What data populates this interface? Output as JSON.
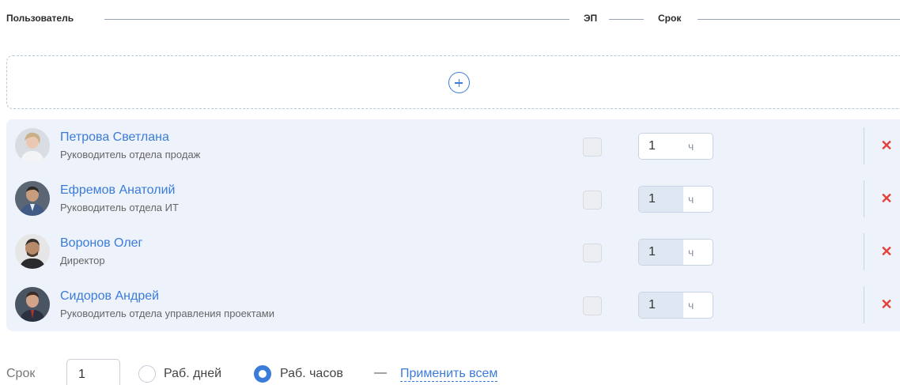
{
  "header": {
    "user_label": "Пользователь",
    "ep_label": "ЭП",
    "term_label": "Срок"
  },
  "add_zone": {
    "icon": "plus-circle-icon"
  },
  "users": [
    {
      "name": "Петрова Светлана",
      "role": "Руководитель отдела продаж",
      "ep_checked": false,
      "term_value": "1",
      "term_unit": "ч"
    },
    {
      "name": "Ефремов Анатолий",
      "role": "Руководитель отдела ИТ",
      "ep_checked": false,
      "term_value": "1",
      "term_unit": "ч"
    },
    {
      "name": "Воронов Олег",
      "role": "Директор",
      "ep_checked": false,
      "term_value": "1",
      "term_unit": "ч"
    },
    {
      "name": "Сидоров Андрей",
      "role": "Руководитель отдела управления проектами",
      "ep_checked": false,
      "term_value": "1",
      "term_unit": "ч"
    }
  ],
  "footer": {
    "term_label": "Срок",
    "term_value": "1",
    "radio_days": "Раб. дней",
    "radio_hours": "Раб. часов",
    "selected": "hours",
    "dash": "—",
    "apply_all": "Применить всем"
  },
  "colors": {
    "accent": "#3b7bd9",
    "delete": "#e5403a",
    "list_bg": "#eef3fb"
  }
}
